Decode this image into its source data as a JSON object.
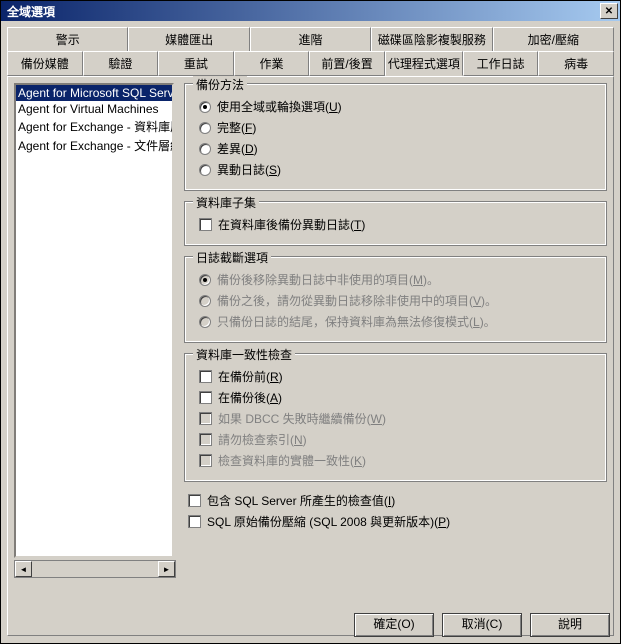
{
  "window": {
    "title": "全域選項"
  },
  "tabs_row1": [
    {
      "label": "警示"
    },
    {
      "label": "媒體匯出"
    },
    {
      "label": "進階"
    },
    {
      "label": "磁碟區陰影複製服務"
    },
    {
      "label": "加密/壓縮"
    }
  ],
  "tabs_row2": [
    {
      "label": "備份媒體"
    },
    {
      "label": "驗證"
    },
    {
      "label": "重試"
    },
    {
      "label": "作業"
    },
    {
      "label": "前置/後置"
    },
    {
      "label": "代理程式選項",
      "active": true
    },
    {
      "label": "工作日誌"
    },
    {
      "label": "病毒"
    }
  ],
  "agent_list": [
    {
      "label": "Agent for Microsoft SQL Server",
      "selected": true
    },
    {
      "label": "Agent for Virtual Machines"
    },
    {
      "label": "Agent for Exchange - 資料庫層級"
    },
    {
      "label": "Agent for Exchange - 文件層級"
    }
  ],
  "groups": {
    "backup_method": {
      "legend": "備份方法",
      "opts": [
        {
          "type": "radio",
          "label": "使用全域或輪換選項(U)",
          "checked": true
        },
        {
          "type": "radio",
          "label": "完整(F)"
        },
        {
          "type": "radio",
          "label": "差異(D)"
        },
        {
          "type": "radio",
          "label": "異動日誌(S)"
        }
      ]
    },
    "db_subset": {
      "legend": "資料庫子集",
      "opts": [
        {
          "type": "checkbox",
          "label": "在資料庫後備份異動日誌(T)"
        }
      ]
    },
    "log_truncate": {
      "legend": "日誌截斷選項",
      "opts": [
        {
          "type": "radio",
          "label": "備份後移除異動日誌中非使用的項目(M)。",
          "disabled": true,
          "checked": true
        },
        {
          "type": "radio",
          "label": "備份之後，請勿從異動日誌移除非使用中的項目(V)。",
          "disabled": true
        },
        {
          "type": "radio",
          "label": "只備份日誌的結尾，保持資料庫為無法修復模式(L)。",
          "disabled": true
        }
      ]
    },
    "db_consistency": {
      "legend": "資料庫一致性檢查",
      "opts": [
        {
          "type": "checkbox",
          "label": "在備份前(R)"
        },
        {
          "type": "checkbox",
          "label": "在備份後(A)"
        },
        {
          "type": "checkbox",
          "label": "如果 DBCC 失敗時繼續備份(W)",
          "disabled": true
        },
        {
          "type": "checkbox",
          "label": "請勿檢查索引(N)",
          "disabled": true
        },
        {
          "type": "checkbox",
          "label": "檢查資料庫的實體一致性(K)",
          "disabled": true
        }
      ]
    }
  },
  "loose_opts": [
    {
      "type": "checkbox",
      "label": "包含 SQL Server 所產生的檢查值(I)"
    },
    {
      "type": "checkbox",
      "label": "SQL 原始備份壓縮 (SQL 2008 與更新版本)(P)"
    }
  ],
  "buttons": {
    "ok": "確定(O)",
    "cancel": "取消(C)",
    "help": "說明"
  }
}
